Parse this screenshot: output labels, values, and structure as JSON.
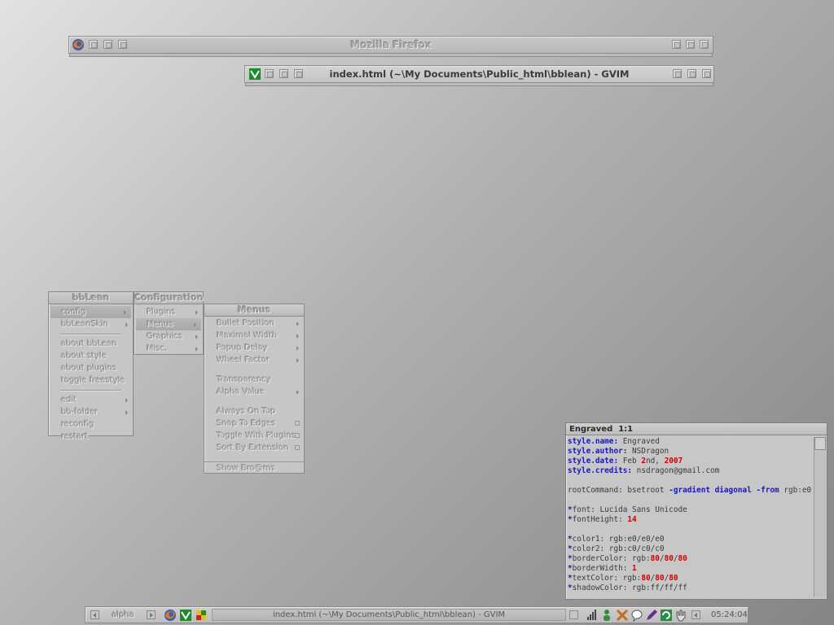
{
  "windows": {
    "firefox_title": "Mozilla Firefox",
    "gvim_title": "index.html (~\\My Documents\\Public_html\\bblean) - GVIM"
  },
  "menus": {
    "root": {
      "title": "bbLean",
      "items": [
        "config",
        "bbLeanSkin",
        "about bbLean",
        "about style",
        "about plugins",
        "toggle freestyle",
        "edit",
        "bb-folder",
        "reconfig",
        "restart"
      ]
    },
    "configuration": {
      "title": "Configuration",
      "items": [
        "Plugins",
        "Menus",
        "Graphics",
        "Misc."
      ]
    },
    "menus_sub": {
      "title": "Menus",
      "items": [
        "Bullet Position",
        "Maximal Width",
        "Popup Delay",
        "Wheel Factor",
        "Transparency",
        "Alpha Value",
        "Always On Top",
        "Snap To Edges",
        "Toggle With Plugins",
        "Sort By Extension",
        "Show Bro@ms"
      ]
    }
  },
  "editor": {
    "title": "Engraved",
    "position": "1:1",
    "lines": [
      [
        {
          "t": "style.name:",
          "c": "k"
        },
        {
          "t": " Engraved",
          "c": ""
        }
      ],
      [
        {
          "t": "style.author:",
          "c": "k"
        },
        {
          "t": " NSDragon",
          "c": ""
        }
      ],
      [
        {
          "t": "style.date:",
          "c": "k"
        },
        {
          "t": " Feb ",
          "c": ""
        },
        {
          "t": "2",
          "c": "r"
        },
        {
          "t": "nd, ",
          "c": ""
        },
        {
          "t": "2007",
          "c": "r"
        }
      ],
      [
        {
          "t": "style.credits:",
          "c": "k"
        },
        {
          "t": " nsdragon@gmail.com",
          "c": ""
        }
      ],
      [],
      [
        {
          "t": "rootCommand: bsetroot ",
          "c": ""
        },
        {
          "t": "-gradient diagonal",
          "c": "k"
        },
        {
          "t": " ",
          "c": ""
        },
        {
          "t": "-from",
          "c": "k"
        },
        {
          "t": " rgb:e0",
          "c": ""
        }
      ],
      [],
      [
        {
          "t": "*",
          "c": "k"
        },
        {
          "t": "font: Lucida Sans Unicode",
          "c": ""
        }
      ],
      [
        {
          "t": "*",
          "c": "k"
        },
        {
          "t": "fontHeight: ",
          "c": ""
        },
        {
          "t": "14",
          "c": "r"
        }
      ],
      [],
      [
        {
          "t": "*",
          "c": "k"
        },
        {
          "t": "color1: rgb:e0/e0/e0",
          "c": ""
        }
      ],
      [
        {
          "t": "*",
          "c": "k"
        },
        {
          "t": "color2: rgb:c0/c0/c0",
          "c": ""
        }
      ],
      [
        {
          "t": "*",
          "c": "k"
        },
        {
          "t": "borderColor: rgb:",
          "c": ""
        },
        {
          "t": "80",
          "c": "r"
        },
        {
          "t": "/",
          "c": ""
        },
        {
          "t": "80",
          "c": "r"
        },
        {
          "t": "/",
          "c": ""
        },
        {
          "t": "80",
          "c": "r"
        }
      ],
      [
        {
          "t": "*",
          "c": "k"
        },
        {
          "t": "borderWidth: ",
          "c": ""
        },
        {
          "t": "1",
          "c": "r"
        }
      ],
      [
        {
          "t": "*",
          "c": "k"
        },
        {
          "t": "textColor: rgb:",
          "c": ""
        },
        {
          "t": "80",
          "c": "r"
        },
        {
          "t": "/",
          "c": ""
        },
        {
          "t": "80",
          "c": "r"
        },
        {
          "t": "/",
          "c": ""
        },
        {
          "t": "80",
          "c": "r"
        }
      ],
      [
        {
          "t": "*",
          "c": "k"
        },
        {
          "t": "shadowColor: rgb:ff/ff/ff",
          "c": ""
        }
      ]
    ]
  },
  "toolbar": {
    "workspace": "alpha",
    "task": "index.html (~\\My Documents\\Public_html\\bblean) - GVIM",
    "clock": "05:24:04"
  },
  "icons": [
    "firefox-icon",
    "gvim-icon",
    "colorful-app-icon",
    "signal-bars-icon",
    "person-icon",
    "tools-icon",
    "balloon-icon",
    "pen-icon",
    "refresh-icon",
    "hand-icon"
  ]
}
